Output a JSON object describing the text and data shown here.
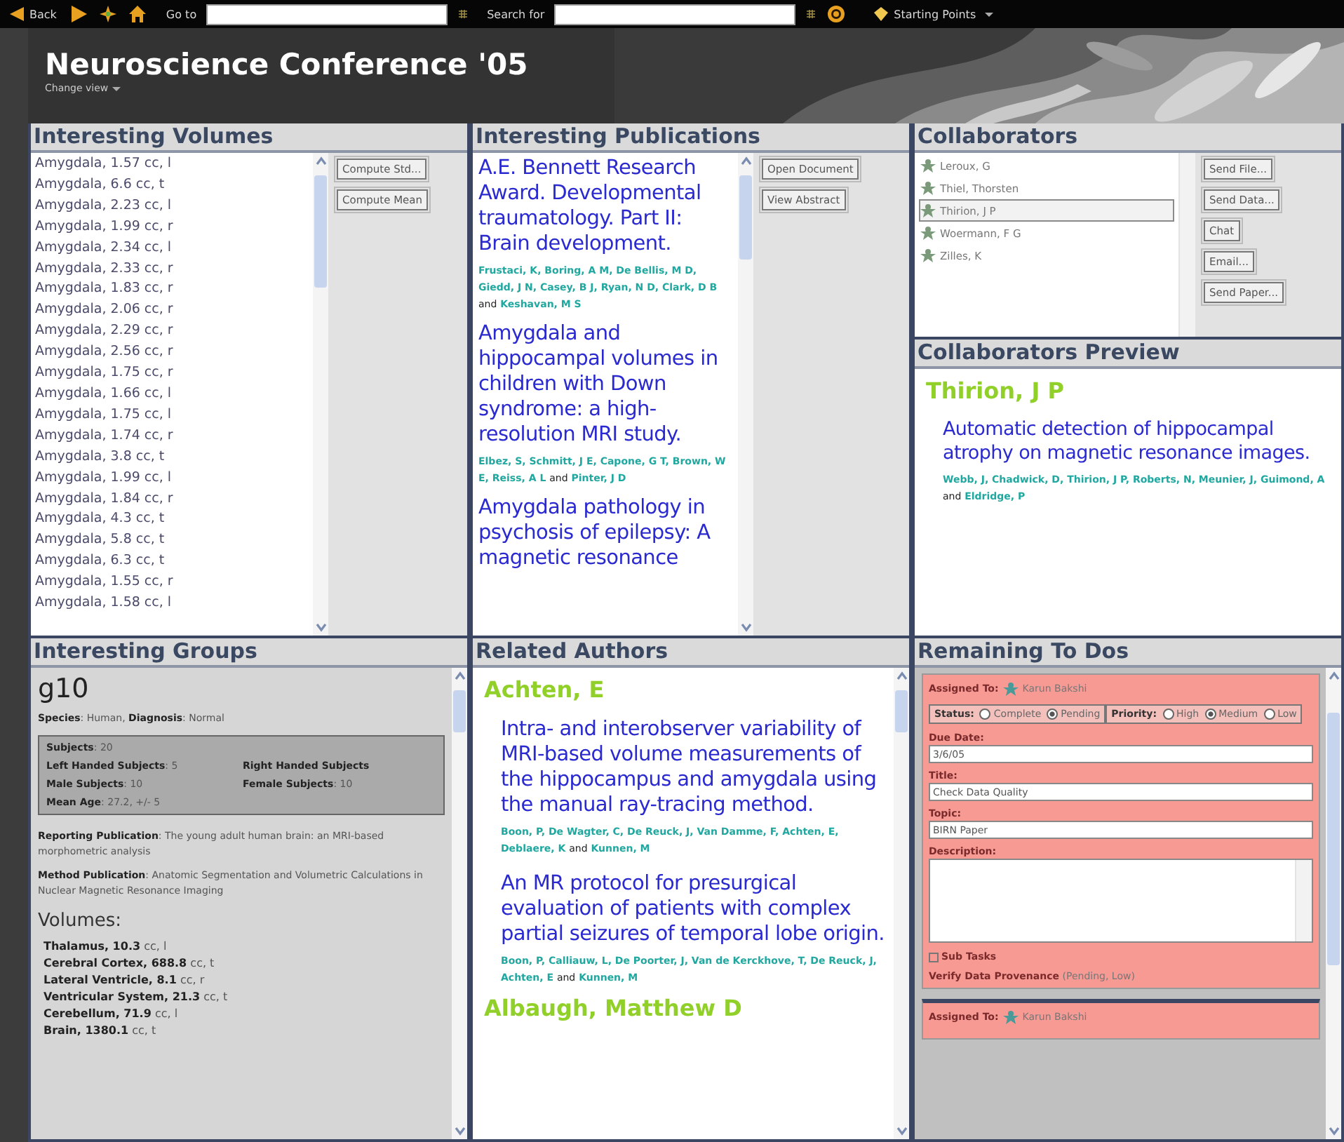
{
  "toolbar": {
    "back": "Back",
    "goto_label": "Go to",
    "search_label": "Search for",
    "starting_points": "Starting Points"
  },
  "header": {
    "title": "Neuroscience Conference '05",
    "change_view": "Change view"
  },
  "volumes": {
    "title": "Interesting Volumes",
    "items": [
      "Amygdala, 1.57 cc, l",
      "Amygdala, 6.6 cc, t",
      "Amygdala, 2.23 cc, l",
      "Amygdala, 1.99 cc, r",
      "Amygdala, 2.34 cc, l",
      "Amygdala, 2.33 cc, r",
      "Amygdala, 1.83 cc, r",
      "Amygdala, 2.06 cc, r",
      "Amygdala, 2.29 cc, r",
      "Amygdala, 2.56 cc, r",
      "Amygdala, 1.75 cc, r",
      "Amygdala, 1.66 cc, l",
      "Amygdala, 1.75 cc, l",
      "Amygdala, 1.74 cc, r",
      "Amygdala, 3.8 cc, t",
      "Amygdala, 1.99 cc, l",
      "Amygdala, 1.84 cc, r",
      "Amygdala, 4.3 cc, t",
      "Amygdala, 5.8 cc, t",
      "Amygdala, 6.3 cc, t",
      "Amygdala, 1.55 cc, r",
      "Amygdala, 1.58 cc, l"
    ],
    "buttons": [
      "Compute Std...",
      "Compute Mean"
    ]
  },
  "publications": {
    "title": "Interesting Publications",
    "items": [
      {
        "title": "A.E. Bennett Research Award. Developmental traumatology. Part II: Brain development.",
        "authors": "Frustaci, K, Boring, A M, De Bellis, M D, Giedd, J N, Casey, B J, Ryan, N D, Clark, D B",
        "conjunction": "and",
        "last_author": "Keshavan, M S"
      },
      {
        "title": "Amygdala and hippocampal volumes in children with Down syndrome: a high-resolution MRI study.",
        "authors": "Elbez, S, Schmitt, J E, Capone, G T, Brown, W E, Reiss, A L",
        "conjunction": "and",
        "last_author": "Pinter, J D"
      },
      {
        "title": "Amygdala pathology in psychosis of epilepsy: A magnetic resonance"
      }
    ],
    "buttons": [
      "Open Document",
      "View Abstract"
    ]
  },
  "collaborators": {
    "title": "Collaborators",
    "items": [
      {
        "name": "Leroux, G",
        "selected": false
      },
      {
        "name": "Thiel, Thorsten",
        "selected": false
      },
      {
        "name": "Thirion, J P",
        "selected": true
      },
      {
        "name": "Woermann, F G",
        "selected": false
      },
      {
        "name": "Zilles, K",
        "selected": false
      }
    ],
    "buttons": [
      "Send File...",
      "Send Data...",
      "Chat",
      "Email...",
      "Send Paper..."
    ]
  },
  "preview": {
    "title": "Collaborators Preview",
    "name": "Thirion, J P",
    "publications": [
      {
        "title": "Automatic detection of hippocampal atrophy on magnetic resonance images.",
        "authors": "Webb, J, Chadwick, D, Thirion, J P, Roberts, N, Meunier, J, Guimond, A",
        "conjunction": "and",
        "last_author": "Eldridge, P"
      }
    ]
  },
  "groups": {
    "title": "Interesting Groups",
    "name": "g10",
    "summary": "**Species**: Human, **Diagnosis**: Normal",
    "stats": [
      [
        "**Subjects**: 20"
      ],
      [
        "**Left Handed Subjects**: 5",
        "**Right Handed Subjects**"
      ],
      [
        "**Male Subjects**: 10",
        "**Female Subjects**: 10"
      ],
      [
        "**Mean Age**: 27.2, +/- 5"
      ]
    ],
    "publications": [
      "**Reporting Publication**: The young adult human brain: an MRI-based morphometric analysis",
      "**Method Publication**: Anatomic Segmentation and Volumetric Calculations in Nuclear Magnetic Resonance Imaging"
    ],
    "volumes_heading": "Volumes:",
    "volumes": [
      "**Thalamus, 10.3** cc, l",
      "**Cerebral Cortex, 688.8** cc, t",
      "**Lateral Ventricle, 8.1** cc, r",
      "**Ventricular System, 21.3** cc, t",
      "**Cerebellum, 71.9** cc, l",
      "**Brain, 1380.1** cc, t"
    ]
  },
  "related_authors": {
    "title": "Related Authors",
    "authors": [
      {
        "name": "Achten, E",
        "publications": [
          {
            "title": "Intra- and interobserver variability of MRI-based volume measurements of the hippocampus and amygdala using the manual ray-tracing method.",
            "authors": "Boon, P, De Wagter, C, De Reuck, J, Van Damme, F, Achten, E, Deblaere, K",
            "conjunction": "and",
            "last_author": "Kunnen, M"
          },
          {
            "title": "An MR protocol for presurgical evaluation of patients with complex partial seizures of temporal lobe origin.",
            "authors": "Boon, P, Calliauw, L, De Poorter, J, Van de Kerckhove, T, De Reuck, J, Achten, E",
            "conjunction": "and",
            "last_author": "Kunnen, M"
          }
        ]
      },
      {
        "name": "Albaugh, Matthew D"
      }
    ]
  },
  "todos": {
    "title": "Remaining To Dos",
    "cards": [
      {
        "assigned_label": "Assigned To:",
        "assignee": "Karun Bakshi",
        "status": {
          "label": "Status:",
          "options": [
            {
              "label": "Complete",
              "selected": false
            },
            {
              "label": "Pending",
              "selected": true
            }
          ]
        },
        "priority": {
          "label": "Priority:",
          "options": [
            {
              "label": "High",
              "selected": false
            },
            {
              "label": "Medium",
              "selected": true
            },
            {
              "label": "Low",
              "selected": false
            }
          ]
        },
        "fields": [
          {
            "label": "Due Date:",
            "kind": "input",
            "value": "3/6/05"
          },
          {
            "label": "Title:",
            "kind": "input",
            "value": "Check Data Quality"
          },
          {
            "label": "Topic:",
            "kind": "input",
            "value": "BIRN Paper"
          },
          {
            "label": "Description:",
            "kind": "textarea"
          }
        ],
        "subtasks": {
          "label": "Sub Tasks",
          "items": [
            {
              "title": "Verify Data Provenance",
              "detail": "(Pending, Low)"
            }
          ]
        }
      },
      {
        "assigned_label": "Assigned To:",
        "assignee": "Karun Bakshi"
      }
    ]
  }
}
